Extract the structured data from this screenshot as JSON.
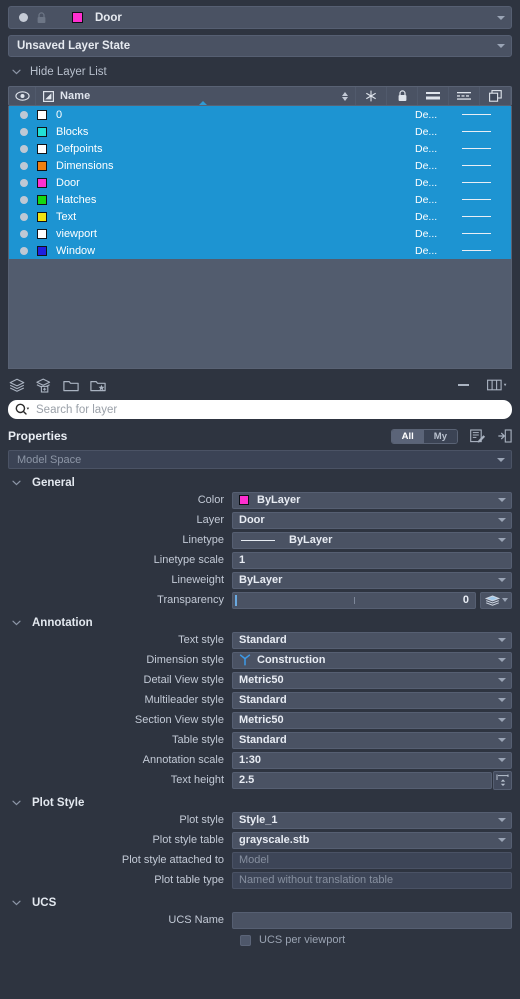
{
  "current_layer": {
    "name": "Door",
    "color": "#ff2fd0",
    "icons": [
      "lightbulb-on-icon",
      "lock-icon",
      "freeze-icon",
      "color-swatch"
    ]
  },
  "layer_state": {
    "value": "Unsaved Layer State"
  },
  "hide_layer_list": {
    "label": "Hide Layer List"
  },
  "layer_table": {
    "columns": [
      {
        "key": "eye",
        "icon": "eye-icon",
        "label": ""
      },
      {
        "key": "name",
        "icon": "layer-icon",
        "label": "Name"
      },
      {
        "key": "freeze",
        "icon": "freeze-icon",
        "label": ""
      },
      {
        "key": "lock",
        "icon": "lock-icon",
        "label": ""
      },
      {
        "key": "lineweight",
        "icon": "lineweight-icon",
        "label": ""
      },
      {
        "key": "linetype",
        "icon": "linetype-icon",
        "label": ""
      },
      {
        "key": "plotstyle",
        "icon": "plot-style-icon",
        "label": ""
      }
    ],
    "rows": [
      {
        "name": "0",
        "color": "#ffffff",
        "lineweight": "De...",
        "linetype": "continuous"
      },
      {
        "name": "Blocks",
        "color": "#22e0d6",
        "lineweight": "De...",
        "linetype": "continuous"
      },
      {
        "name": "Defpoints",
        "color": "#ffffff",
        "lineweight": "De...",
        "linetype": "continuous"
      },
      {
        "name": "Dimensions",
        "color": "#f08010",
        "lineweight": "De...",
        "linetype": "continuous"
      },
      {
        "name": "Door",
        "color": "#ff2fd0",
        "lineweight": "De...",
        "linetype": "continuous"
      },
      {
        "name": "Hatches",
        "color": "#16d813",
        "lineweight": "De...",
        "linetype": "continuous"
      },
      {
        "name": "Text",
        "color": "#f2e313",
        "lineweight": "De...",
        "linetype": "continuous"
      },
      {
        "name": "viewport",
        "color": "#ffffff",
        "lineweight": "De...",
        "linetype": "continuous"
      },
      {
        "name": "Window",
        "color": "#1f1fe0",
        "lineweight": "De...",
        "linetype": "continuous"
      }
    ]
  },
  "list_toolbar": {
    "buttons": [
      {
        "name": "new-layer-icon"
      },
      {
        "name": "new-layer-viewport-icon"
      },
      {
        "name": "layer-states-folder-icon"
      },
      {
        "name": "layer-filter-folder-icon"
      }
    ],
    "collapse": {
      "name": "collapse-icon"
    },
    "columns_menu": {
      "name": "columns-icon"
    }
  },
  "search": {
    "placeholder": "Search for layer",
    "value": "",
    "icon": "search-icon"
  },
  "properties_header": {
    "title": "Properties",
    "toggle": {
      "all": "All",
      "my": "My",
      "selected": "All"
    },
    "edit_icon": "edit-properties-icon",
    "panel_icon": "collapse-panel-icon"
  },
  "space_selector": {
    "value": "Model Space"
  },
  "sections": [
    {
      "title": "General",
      "rows": [
        {
          "label": "Color",
          "value": "ByLayer",
          "type": "dropdown",
          "swatch": "#ff2fd0"
        },
        {
          "label": "Layer",
          "value": "Door",
          "type": "dropdown"
        },
        {
          "label": "Linetype",
          "value": "ByLayer",
          "type": "dropdown-line"
        },
        {
          "label": "Linetype scale",
          "value": "1",
          "type": "text"
        },
        {
          "label": "Lineweight",
          "value": "ByLayer",
          "type": "dropdown"
        },
        {
          "label": "Transparency",
          "value": "0",
          "type": "slider"
        }
      ]
    },
    {
      "title": "Annotation",
      "rows": [
        {
          "label": "Text style",
          "value": "Standard",
          "type": "dropdown"
        },
        {
          "label": "Dimension style",
          "value": "Construction",
          "type": "dropdown-dim"
        },
        {
          "label": "Detail View style",
          "value": "Metric50",
          "type": "dropdown"
        },
        {
          "label": "Multileader style",
          "value": "Standard",
          "type": "dropdown"
        },
        {
          "label": "Section View style",
          "value": "Metric50",
          "type": "dropdown"
        },
        {
          "label": "Table style",
          "value": "Standard",
          "type": "dropdown"
        },
        {
          "label": "Annotation scale",
          "value": "1:30",
          "type": "dropdown"
        },
        {
          "label": "Text height",
          "value": "2.5",
          "type": "spinner"
        }
      ]
    },
    {
      "title": "Plot Style",
      "rows": [
        {
          "label": "Plot style",
          "value": "Style_1",
          "type": "dropdown"
        },
        {
          "label": "Plot style table",
          "value": "grayscale.stb",
          "type": "dropdown"
        },
        {
          "label": "Plot style attached to",
          "value": "Model",
          "type": "readonly"
        },
        {
          "label": "Plot table type",
          "value": "Named without translation table",
          "type": "readonly"
        }
      ]
    },
    {
      "title": "UCS",
      "rows": [
        {
          "label": "UCS Name",
          "value": "",
          "type": "text"
        }
      ],
      "checkbox": {
        "label": "UCS per viewport",
        "checked": false
      }
    }
  ],
  "colors": {
    "background": "#2e3440",
    "selection": "#1d94d2",
    "field": "#4a5263",
    "accent": "#2f9ad4"
  }
}
